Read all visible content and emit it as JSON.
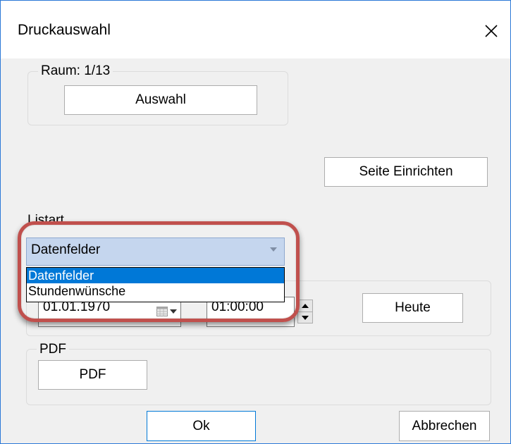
{
  "window": {
    "title": "Druckauswahl"
  },
  "room_group": {
    "label": "Raum: 1/13",
    "select_button": "Auswahl"
  },
  "page_setup_button": "Seite Einrichten",
  "list_type": {
    "label": "Listart",
    "selected": "Datenfelder",
    "options": [
      "Datenfelder",
      "Stundenwünsche"
    ]
  },
  "datetime": {
    "date_value": "01.01.1970",
    "time_value": "01:00:00",
    "today_button": "Heute"
  },
  "pdf_group": {
    "label": "PDF",
    "button": "PDF"
  },
  "footer": {
    "ok_button": "Ok",
    "cancel_button": "Abbrechen"
  },
  "colors": {
    "accent": "#0078d7",
    "combo_selected_bg": "#c5d6ee",
    "highlight_ring": "#c0504d"
  }
}
